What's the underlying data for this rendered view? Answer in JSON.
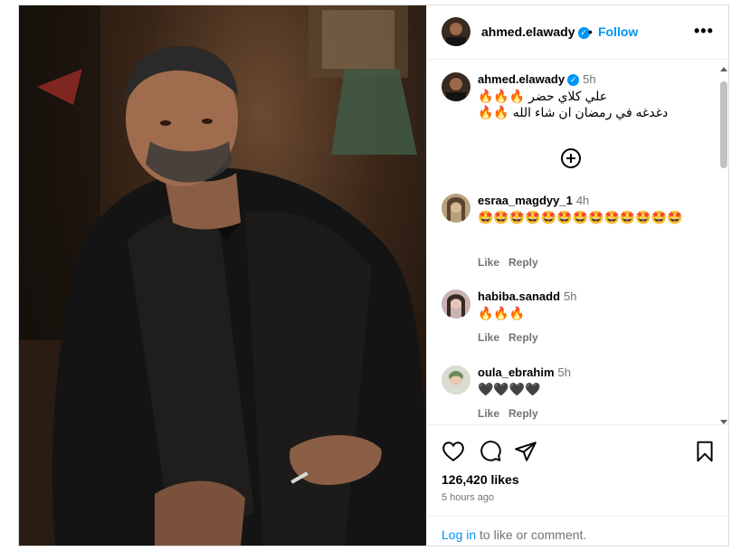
{
  "header": {
    "username": "ahmed.elawady",
    "verified_mark": "✓",
    "separator": "•",
    "follow_label": "Follow",
    "more_label": "•••"
  },
  "caption": {
    "username": "ahmed.elawady",
    "time": "5h",
    "line1": "علي كلاي حضر 🔥🔥🔥",
    "line2": "دغدغه في رمضان ان شاء الله 🔥🔥"
  },
  "comments": [
    {
      "username": "esraa_magdyy_1",
      "time": "4h",
      "text": "🤩🤩🤩🤩🤩🤩🤩🤩🤩🤩🤩🤩🤩",
      "like": "Like",
      "reply": "Reply"
    },
    {
      "username": "habiba.sanadd",
      "time": "5h",
      "text": "🔥🔥🔥",
      "like": "Like",
      "reply": "Reply"
    },
    {
      "username": "oula_ebrahim",
      "time": "5h",
      "text": "🖤🖤🖤🖤",
      "like": "Like",
      "reply": "Reply"
    }
  ],
  "icons": {
    "like": "heart-icon",
    "comment": "comment-icon",
    "share": "send-icon",
    "save": "bookmark-icon",
    "load_more": "plus-circle-icon",
    "more": "more-options-icon"
  },
  "footer": {
    "likes": "126,420 likes",
    "time_ago": "5 hours ago",
    "login_link": "Log in",
    "login_rest": " to like or comment."
  },
  "colors": {
    "accent": "#0095f6",
    "muted": "#737373",
    "border": "#dbdbdb"
  }
}
